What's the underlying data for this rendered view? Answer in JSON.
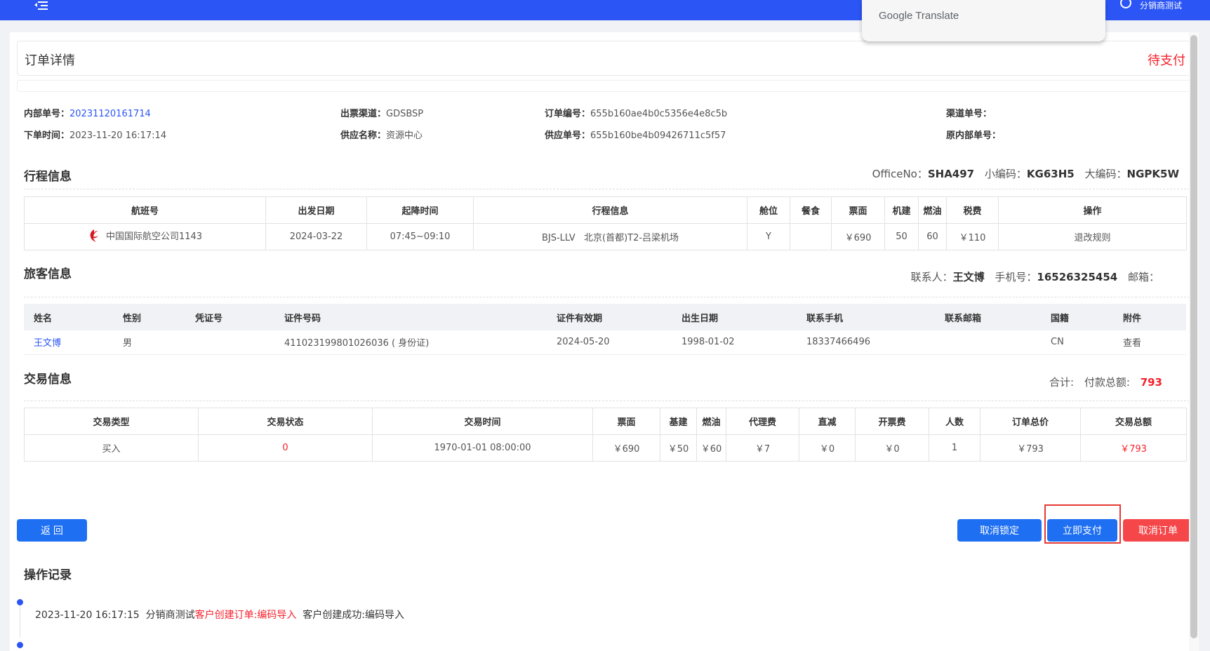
{
  "topbar": {
    "user_name": "分销商测试"
  },
  "google_translate": {
    "label": "Google Translate"
  },
  "header": {
    "title": "订单详情",
    "status": "待支付"
  },
  "order_info": {
    "internal_no_label": "内部单号：",
    "internal_no": "20231120161714",
    "channel_label": "出票渠道：",
    "channel": "GDSBSP",
    "order_no_label": "订单编号：",
    "order_no": "655b160ae4b0c5356e4e8c5b",
    "channel_no_label": "渠道单号：",
    "channel_no": "",
    "order_time_label": "下单时间：",
    "order_time": "2023-11-20 16:17:14",
    "supplier_label": "供应名称：",
    "supplier": "资源中心",
    "supplier_no_label": "供应单号：",
    "supplier_no": "655b160be4b09426711c5f57",
    "orig_internal_label": "原内部单号：",
    "orig_internal": ""
  },
  "itinerary": {
    "title": "行程信息",
    "office_label": "OfficeNo：",
    "office": "SHA497",
    "small_code_label": "小编码：",
    "small_code": "KG63H5",
    "big_code_label": "大编码：",
    "big_code": "NGPK5W",
    "headers": [
      "航班号",
      "出发日期",
      "起降时间",
      "行程信息",
      "舱位",
      "餐食",
      "票面",
      "机建",
      "燃油",
      "税费",
      "操作"
    ],
    "row": {
      "flight": "中国国际航空公司1143",
      "date": "2024-03-22",
      "time": "07:45~09:10",
      "route": "BJS-LLV   北京(首都)T2-吕梁机场",
      "cabin": "Y",
      "meal": "",
      "fare": "￥690",
      "airport_fee": "50",
      "fuel": "60",
      "tax": "￥110",
      "action": "退改规则"
    }
  },
  "passenger": {
    "title": "旅客信息",
    "contact_label": "联系人：",
    "contact": "王文博",
    "phone_label": "手机号：",
    "phone": "16526325454",
    "email_label": "邮箱：",
    "email": "",
    "headers": [
      "姓名",
      "性别",
      "凭证号",
      "证件号码",
      "证件有效期",
      "出生日期",
      "联系手机",
      "联系邮箱",
      "国籍",
      "附件"
    ],
    "row": {
      "name": "王文博",
      "gender": "男",
      "voucher": "",
      "id_no": "411023199801026036 ( 身份证)",
      "id_expiry": "2024-05-20",
      "birth": "1998-01-02",
      "mobile": "18337466496",
      "email": "",
      "nationality": "CN",
      "attachment": "查看"
    }
  },
  "transaction": {
    "title": "交易信息",
    "total_label": "合计:",
    "pay_label": "付款总额:",
    "pay_total": "793",
    "headers": [
      "交易类型",
      "交易状态",
      "交易时间",
      "票面",
      "基建",
      "燃油",
      "代理费",
      "直减",
      "开票费",
      "人数",
      "订单总价",
      "交易总额"
    ],
    "row": {
      "type": "买入",
      "status": "0",
      "time": "1970-01-01 08:00:00",
      "fare": "￥690",
      "base": "￥50",
      "fuel": "￥60",
      "agent_fee": "￥7",
      "discount": "￥0",
      "issue_fee": "￥0",
      "count": "1",
      "order_total": "￥793",
      "trade_total": "￥793"
    }
  },
  "buttons": {
    "back": "返 回",
    "cancel_lock": "取消锁定",
    "pay_now": "立即支付",
    "cancel_order": "取消订单"
  },
  "log": {
    "title": "操作记录",
    "entry_time": "2023-11-20 16:17:15",
    "entry_user": "分销商测试",
    "entry_action": "客户创建订单:编码导入",
    "entry_result": "客户创建成功:编码导入"
  },
  "colors": {
    "topbar": "#2b55f5",
    "accent": "#1e6ff2",
    "danger": "#f5222d"
  }
}
